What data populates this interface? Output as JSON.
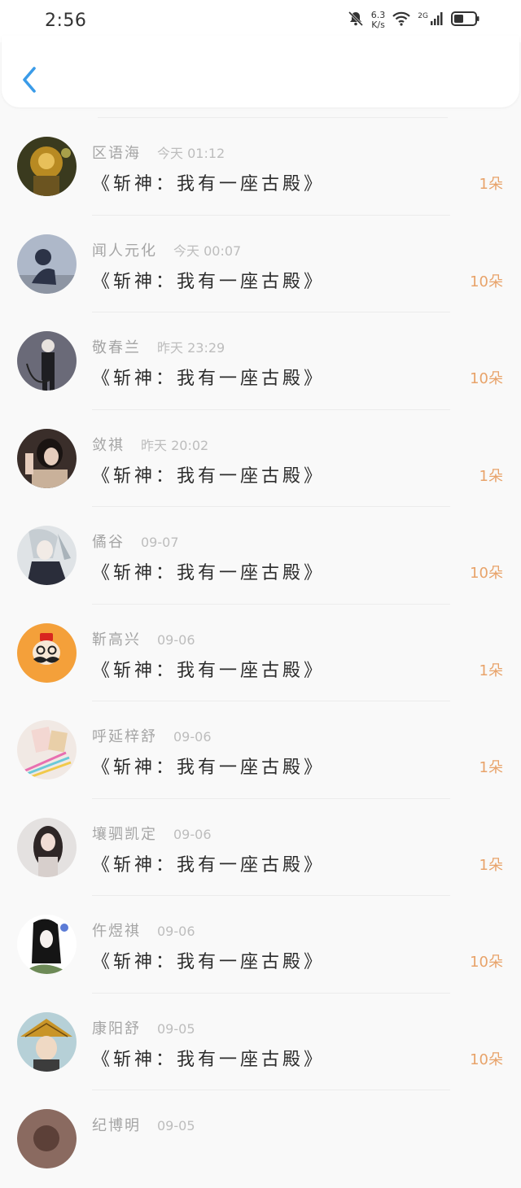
{
  "status_bar": {
    "time": "2:56",
    "speed_value": "6.3",
    "speed_unit": "K/s",
    "network": "2G",
    "icons": [
      "bell-muted-icon",
      "wifi-icon",
      "signal-icon",
      "battery-icon"
    ]
  },
  "header": {
    "back_icon": "back-arrow-icon",
    "accent": "#3a9be8"
  },
  "colors": {
    "amount": "#e8a36a",
    "name": "#a5a5a5",
    "time": "#bdbdbd"
  },
  "records": [
    {
      "name": "区语海",
      "time": "今天 01:12",
      "book": "《斩神：我有一座古殿》",
      "amount": "1朵"
    },
    {
      "name": "闻人元化",
      "time": "今天 00:07",
      "book": "《斩神：我有一座古殿》",
      "amount": "10朵"
    },
    {
      "name": "敬春兰",
      "time": "昨天 23:29",
      "book": "《斩神：我有一座古殿》",
      "amount": "10朵"
    },
    {
      "name": "敛祺",
      "time": "昨天 20:02",
      "book": "《斩神：我有一座古殿》",
      "amount": "1朵"
    },
    {
      "name": "僪谷",
      "time": "09-07",
      "book": "《斩神：我有一座古殿》",
      "amount": "10朵"
    },
    {
      "name": "靳高兴",
      "time": "09-06",
      "book": "《斩神：我有一座古殿》",
      "amount": "1朵"
    },
    {
      "name": "呼延梓舒",
      "time": "09-06",
      "book": "《斩神：我有一座古殿》",
      "amount": "1朵"
    },
    {
      "name": "壤驷凯定",
      "time": "09-06",
      "book": "《斩神：我有一座古殿》",
      "amount": "1朵"
    },
    {
      "name": "仵煜祺",
      "time": "09-06",
      "book": "《斩神：我有一座古殿》",
      "amount": "10朵"
    },
    {
      "name": "康阳舒",
      "time": "09-05",
      "book": "《斩神：我有一座古殿》",
      "amount": "10朵"
    },
    {
      "name": "纪博明",
      "time": "09-05",
      "book": "",
      "amount": ""
    }
  ]
}
